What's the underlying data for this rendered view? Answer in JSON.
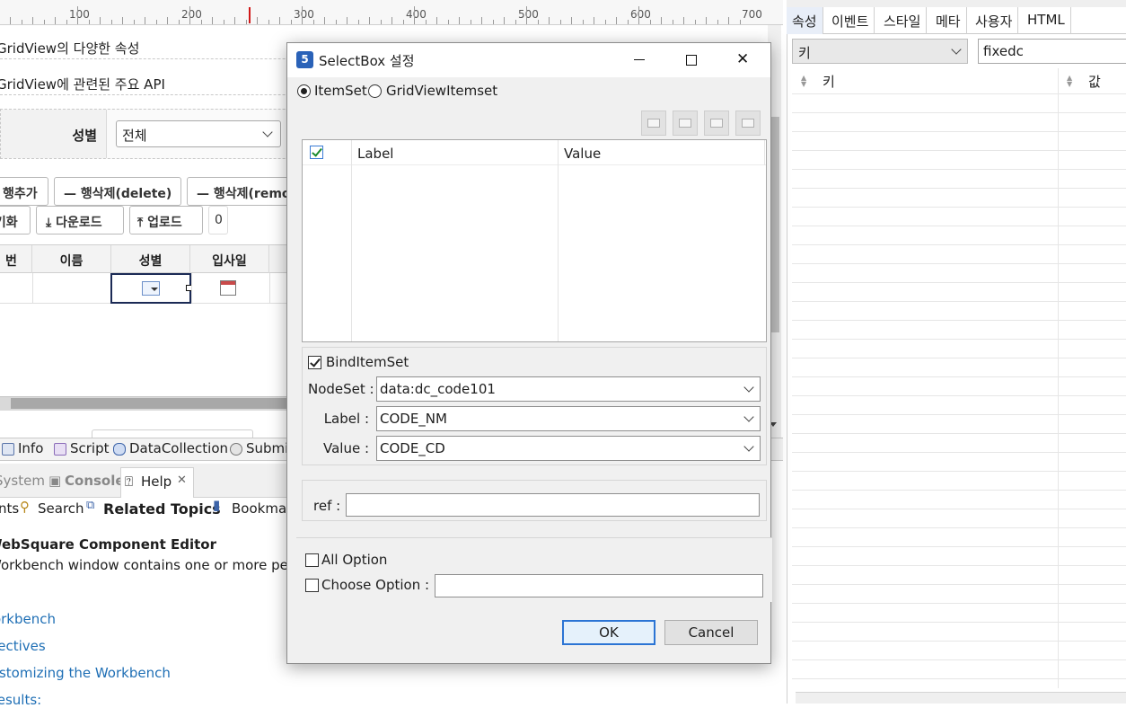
{
  "editor": {
    "ruler": {
      "labels": [
        "100",
        "200",
        "300",
        "400",
        "500",
        "600",
        "700"
      ]
    },
    "title1": "GridView의 다양한 속성",
    "title2": "GridView에 관련된 주요 API",
    "search": {
      "gender_label": "성별",
      "gender_value": "전체"
    },
    "buttons_row1": [
      "행추가",
      "행삭제(delete)",
      "행삭제(remove)"
    ],
    "buttons_row2": [
      "초기화",
      "다운로드",
      "업로드"
    ],
    "row_count": "0",
    "grid_columns": [
      "번",
      "이름",
      "성별",
      "입사일"
    ]
  },
  "design_tabs": [
    "Info",
    "Script",
    "DataCollection",
    "Submission"
  ],
  "help_view": {
    "tabs": [
      "System",
      "Console",
      "Help"
    ],
    "toolbar": [
      "nts",
      "Search",
      "Related Topics",
      "Bookmarks"
    ],
    "heading": "WebSquare Component Editor",
    "body": "Workbench window contains one or more perspectives",
    "links": [
      "Workbench",
      "Perspectives",
      "Customizing the Workbench",
      "Results:"
    ]
  },
  "properties": {
    "tabs": [
      "속성",
      "이벤트",
      "스타일",
      "메타",
      "사용자",
      "HTML"
    ],
    "active_tab": "속성",
    "key_select": "키",
    "filter_value": "fixedc",
    "columns": {
      "key": "키",
      "value": "값"
    }
  },
  "dialog": {
    "icon_text": "5",
    "title": "SelectBox 설정",
    "radio_itemset": "ItemSet",
    "radio_gridview": "GridViewItemset",
    "radio_selected": "ItemSet",
    "table_headers": {
      "label": "Label",
      "value": "Value"
    },
    "bind_itemset": {
      "label": "BindItemSet",
      "checked": true
    },
    "nodeset": {
      "label": "NodeSet :",
      "value": "data:dc_code101"
    },
    "label_field": {
      "label": "Label :",
      "value": "CODE_NM"
    },
    "value_field": {
      "label": "Value :",
      "value": "CODE_CD"
    },
    "ref": {
      "label": "ref :",
      "value": ""
    },
    "all_option": {
      "label": "All Option",
      "checked": false
    },
    "choose_option": {
      "label": "Choose Option :",
      "value": "",
      "checked": false
    },
    "ok": "OK",
    "cancel": "Cancel"
  },
  "colors": {
    "accent": "#2b74d4",
    "link": "#1f6fb5",
    "ruler_marker": "#d01818"
  }
}
